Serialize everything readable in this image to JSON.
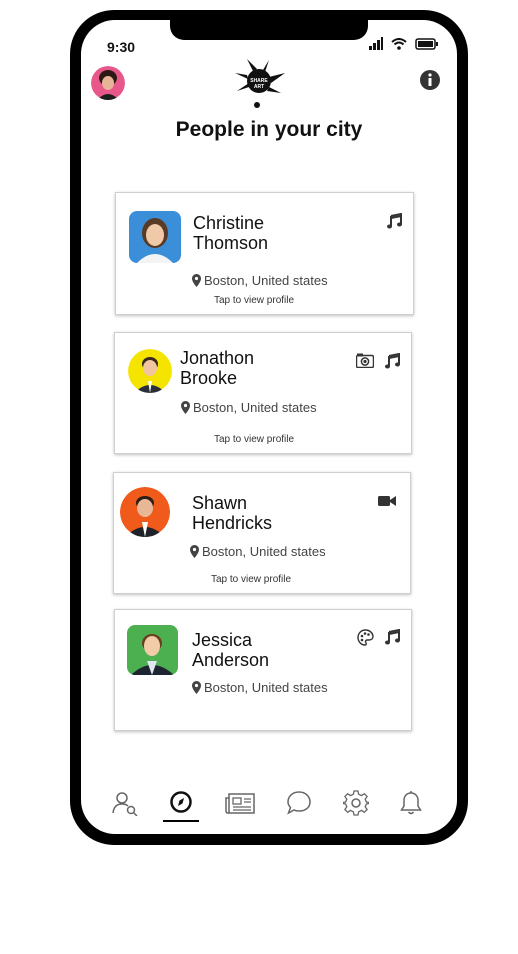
{
  "status": {
    "time": "9:30"
  },
  "header": {
    "title": "People in your city"
  },
  "cards": [
    {
      "first": "Christine",
      "last": "Thomson",
      "location": "Boston, United states",
      "tap": "Tap to view profile",
      "icons": [
        "music-icon"
      ]
    },
    {
      "first": "Jonathon",
      "last": "Brooke",
      "location": "Boston, United states",
      "tap": "Tap to view profile",
      "icons": [
        "camera-icon",
        "music-icon"
      ]
    },
    {
      "first": "Shawn",
      "last": "Hendricks",
      "location": "Boston, United states",
      "tap": "Tap to view profile",
      "icons": [
        "video-icon"
      ]
    },
    {
      "first": "Jessica",
      "last": "Anderson",
      "location": "Boston, United states",
      "icons": [
        "palette-icon",
        "music-icon"
      ]
    }
  ],
  "nav": {
    "items": [
      "profile-search-icon",
      "compass-icon",
      "newspaper-icon",
      "chat-icon",
      "settings-icon",
      "bell-icon"
    ],
    "active": "compass-icon"
  },
  "colors": {
    "frame": "#000000",
    "card_border": "#cfcfcf",
    "avatar_bg_1": "#3b8fd9",
    "avatar_bg_2": "#f5e400",
    "avatar_bg_3": "#f05a1a",
    "avatar_bg_4": "#4caf50"
  }
}
